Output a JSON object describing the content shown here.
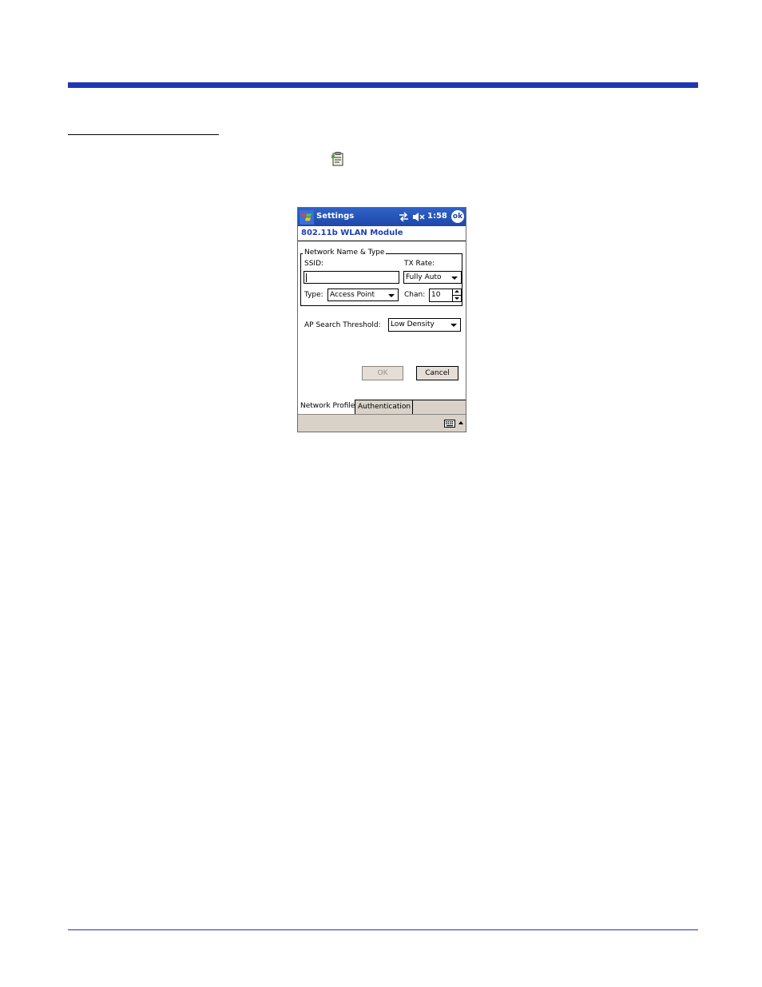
{
  "device": {
    "title": "Settings",
    "clock": "1:58",
    "ok_label": "ok",
    "module_title": "802.11b WLAN Module",
    "group_label": "Network Name & Type",
    "ssid_label": "SSID:",
    "ssid_value": "",
    "tx_rate_label": "TX Rate:",
    "tx_rate_value": "Fully Auto",
    "type_label": "Type:",
    "type_value": "Access Point",
    "chan_label": "Chan:",
    "chan_value": "10",
    "ap_threshold_label": "AP Search Threshold:",
    "ap_threshold_value": "Low Density",
    "ok_button": "OK",
    "cancel_button": "Cancel",
    "tabs": [
      {
        "label": "Network Profile",
        "active": true
      },
      {
        "label": "Authentication",
        "active": false
      }
    ]
  },
  "colors": {
    "accent": "#1f36b5",
    "titlebar": "#2f62c8",
    "panel": "#d8d2c9"
  },
  "icons": [
    "document-icon",
    "windows-flag-icon",
    "connectivity-icon",
    "speaker-muted-icon",
    "ok-icon",
    "keyboard-icon",
    "chevron-up-icon"
  ]
}
